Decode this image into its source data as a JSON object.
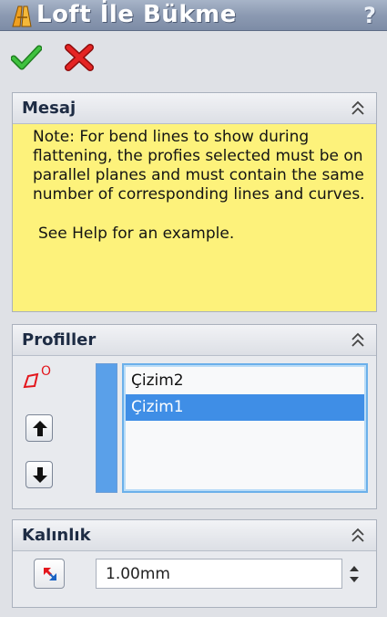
{
  "window": {
    "title": "Loft İle Bükme",
    "help_label": "?"
  },
  "toolbar": {
    "ok_icon": "checkmark-icon",
    "cancel_icon": "x-icon"
  },
  "message_panel": {
    "title": "Mesaj",
    "note": "Note: For bend lines to show during flattening, the profies selected must be on parallel planes and must contain the same number of corresponding lines and curves.",
    "help_text": "See Help for an example.",
    "background_color": "#fdf27b"
  },
  "profiles_panel": {
    "title": "Profiller",
    "icon_superscript": "O",
    "items": [
      {
        "label": "Çizim2",
        "selected": false
      },
      {
        "label": "Çizim1",
        "selected": true
      }
    ],
    "selection_color": "#3f8ee6"
  },
  "thickness_panel": {
    "title": "Kalınlık",
    "value": "1.00mm"
  }
}
